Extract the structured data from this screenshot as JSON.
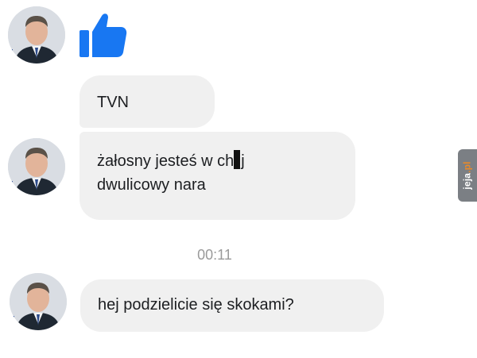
{
  "conversation": {
    "messages": [
      {
        "type": "reaction",
        "icon": "thumbs-up-icon"
      },
      {
        "type": "text",
        "lines": [
          "TVN"
        ]
      },
      {
        "type": "text",
        "lines_before_censor": "żałosny jesteś w ch",
        "line_after_censor": "j",
        "second_line": "dwulicowy nara"
      },
      {
        "type": "timestamp",
        "text": "00:11"
      },
      {
        "type": "text",
        "lines": [
          "hej podzielicie się skokami?"
        ]
      }
    ]
  },
  "watermark": {
    "site": "jeja",
    "suffix": ".pl"
  },
  "colors": {
    "like_blue": "#1877f2",
    "bubble_bg": "#f0f0f0",
    "timestamp_gray": "#9a9a9a",
    "watermark_bg": "#7b7f84",
    "watermark_accent": "#e8892a"
  }
}
